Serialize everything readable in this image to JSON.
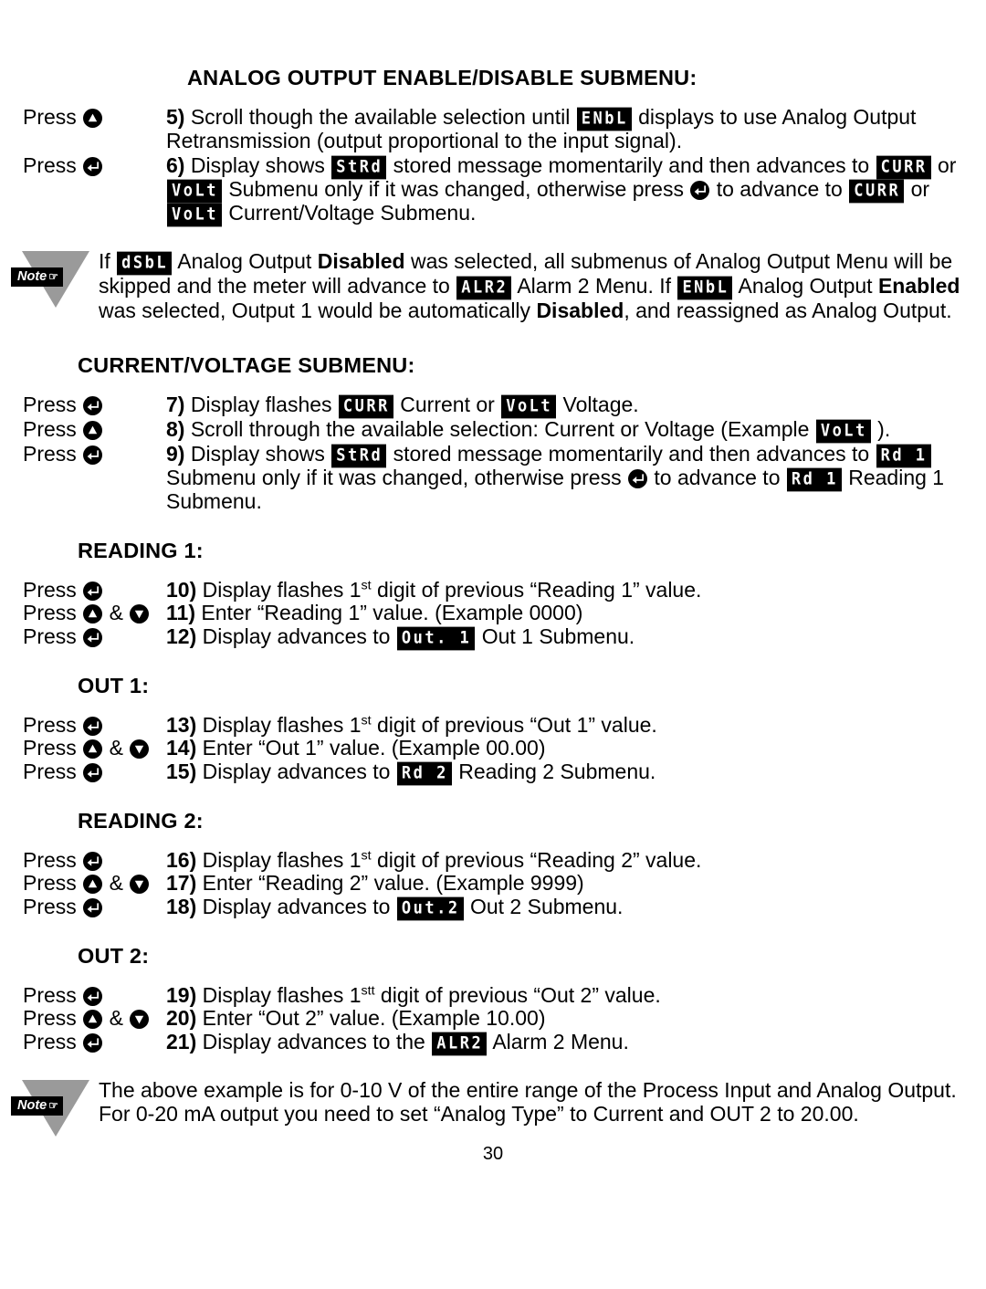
{
  "page": {
    "number": "30"
  },
  "icons": {
    "up": "up-arrow-key-icon",
    "down": "down-arrow-key-icon",
    "enter": "enter-key-icon",
    "note": "note-triangle-icon"
  },
  "note_badge": {
    "label": "Note",
    "hand": "☞"
  },
  "sections": [
    {
      "id": "analog-output-enable-disable-submenu",
      "heading": "ANALOG OUTPUT ENABLE/DISABLE SUBMENU:",
      "rows": [
        {
          "press_label": "Press",
          "keys": [
            "up"
          ],
          "step": "5)",
          "lines": [
            "Scroll though the available selection until ",
            " displays to use Analog Output Retransmission (output proportional to the input signal)."
          ],
          "lcd": [
            "ENbL"
          ]
        },
        {
          "press_label": "Press",
          "keys": [
            "enter"
          ],
          "step": "6)",
          "lcd": [
            "StRd",
            "CURR",
            "VoLt",
            "CURR",
            "VoLt"
          ]
        }
      ]
    },
    {
      "id": "note-analog-disabled",
      "heading": "",
      "note": true
    },
    {
      "id": "current-voltage-submenu",
      "heading": "CURRENT/VOLTAGE SUBMENU:",
      "rows": [
        {
          "press_label": "Press",
          "keys": [
            "enter"
          ],
          "step": "7)",
          "lcd": [
            "CURR",
            "VoLt"
          ]
        },
        {
          "press_label": "Press",
          "keys": [
            "up"
          ],
          "step": "8)",
          "lcd": [
            "VoLt"
          ]
        },
        {
          "press_label": "Press",
          "keys": [
            "enter"
          ],
          "step": "9)",
          "lcd": [
            "StRd",
            "Rd 1",
            "Rd 1"
          ]
        }
      ]
    },
    {
      "id": "reading-1",
      "heading": "READING 1:",
      "rows": [
        {
          "press_label": "Press",
          "keys": [
            "enter"
          ],
          "step": "10)"
        },
        {
          "press_label": "Press",
          "keys": [
            "up",
            "down"
          ],
          "step": "11)"
        },
        {
          "press_label": "Press",
          "keys": [
            "enter"
          ],
          "step": "12)",
          "lcd": [
            "Out. 1"
          ]
        }
      ]
    },
    {
      "id": "out-1",
      "heading": "OUT 1:",
      "rows": [
        {
          "press_label": "Press",
          "keys": [
            "enter"
          ],
          "step": "13)"
        },
        {
          "press_label": "Press",
          "keys": [
            "up",
            "down"
          ],
          "step": "14)"
        },
        {
          "press_label": "Press",
          "keys": [
            "enter"
          ],
          "step": "15)",
          "lcd": [
            "Rd 2"
          ]
        }
      ]
    },
    {
      "id": "reading-2",
      "heading": "READING 2:",
      "rows": [
        {
          "press_label": "Press",
          "keys": [
            "enter"
          ],
          "step": "16)"
        },
        {
          "press_label": "Press",
          "keys": [
            "up",
            "down"
          ],
          "step": "17)"
        },
        {
          "press_label": "Press",
          "keys": [
            "enter"
          ],
          "step": "18)",
          "lcd": [
            "Out.2"
          ]
        }
      ]
    },
    {
      "id": "out-2",
      "heading": "OUT 2:",
      "rows": [
        {
          "press_label": "Press",
          "keys": [
            "enter"
          ],
          "step": "19)"
        },
        {
          "press_label": "Press",
          "keys": [
            "up",
            "down"
          ],
          "step": "20)"
        },
        {
          "press_label": "Press",
          "keys": [
            "enter"
          ],
          "step": "21)",
          "lcd": [
            "ALR2"
          ]
        }
      ]
    }
  ],
  "text": {
    "heading_analog": "ANALOG OUTPUT ENABLE/DISABLE SUBMENU:",
    "heading_current_voltage": "CURRENT/VOLTAGE SUBMENU:",
    "heading_reading_1": "READING 1:",
    "heading_out_1": "OUT 1:",
    "heading_reading_2": "READING 2:",
    "heading_out_2": "OUT 2:",
    "press": "Press",
    "amp": "&",
    "step5_num": "5)",
    "step5_a": "Scroll though the available selection until",
    "step5_lcd": "ENbL",
    "step5_b": "displays to use Analog Output Retransmission (output proportional to the input signal).",
    "step6_num": "6)",
    "step6_a": "Display shows",
    "step6_lcd1": "StRd",
    "step6_b": "stored message momentarily and then advances to",
    "step6_lcd2": "CURR",
    "step6_c": "or",
    "step6_lcd3": "VoLt",
    "step6_d": "Submenu only if it was changed, otherwise press",
    "step6_e": "to advance to",
    "step6_lcd4": "CURR",
    "step6_f": "or",
    "step6_lcd5": "VoLt",
    "step6_g": "Current/Voltage Submenu.",
    "note1_a": "If",
    "note1_lcd1": "dSbL",
    "note1_b": "Analog Output",
    "note1_bold1": "Disabled",
    "note1_c": "was selected, all submenus of Analog Output Menu will be skipped and the meter will advance to",
    "note1_lcd2": "ALR2",
    "note1_d": "Alarm 2 Menu. If",
    "note1_lcd3": "ENbL",
    "note1_e": "Analog Output",
    "note1_bold2": "Enabled",
    "note1_f": "was selected, Output 1 would be automatically",
    "note1_bold3": "Disabled",
    "note1_g": ", and reassigned as Analog Output.",
    "step7_num": "7)",
    "step7_a": "Display flashes",
    "step7_lcd1": "CURR",
    "step7_b": "Current or",
    "step7_lcd2": "VoLt",
    "step7_c": "Voltage.",
    "step8_num": "8)",
    "step8_a": "Scroll through the available selection: Current or Voltage (Example",
    "step8_lcd": "VoLt",
    "step8_b": ").",
    "step9_num": "9)",
    "step9_a": "Display shows",
    "step9_lcd1": "StRd",
    "step9_b": "stored message momentarily and then advances to",
    "step9_lcd2": "Rd 1",
    "step9_c": "Submenu only if it was changed, otherwise press",
    "step9_d": "to advance to",
    "step9_lcd3": "Rd 1",
    "step9_e": "Reading 1 Submenu.",
    "step10_num": "10)",
    "step10_a": "Display flashes 1",
    "step10_ord": "st",
    "step10_b": " digit of previous “Reading 1” value.",
    "step11_num": "11)",
    "step11_a": "Enter “Reading 1” value. (Example 0000)",
    "step12_num": "12)",
    "step12_a": "Display advances to",
    "step12_lcd": "Out. 1",
    "step12_b": "Out 1 Submenu.",
    "step13_num": "13)",
    "step13_a": "Display flashes 1",
    "step13_ord": "st",
    "step13_b": " digit of previous “Out 1” value.",
    "step14_num": "14)",
    "step14_a": "Enter “Out 1” value. (Example 00.00)",
    "step15_num": "15)",
    "step15_a": "Display advances to",
    "step15_lcd": "Rd 2",
    "step15_b": "Reading 2 Submenu.",
    "step16_num": "16)",
    "step16_a": "Display flashes 1",
    "step16_ord": "st",
    "step16_b": " digit of previous “Reading 2” value.",
    "step17_num": "17)",
    "step17_a": "Enter “Reading 2” value. (Example 9999)",
    "step18_num": "18)",
    "step18_a": "Display advances to",
    "step18_lcd": "Out.2",
    "step18_b": "Out 2 Submenu.",
    "step19_num": "19)",
    "step19_a": "Display flashes 1",
    "step19_ord": "stt",
    "step19_b": " digit of previous “Out 2” value.",
    "step20_num": "20)",
    "step20_a": "Enter “Out 2” value. (Example 10.00)",
    "step21_num": "21)",
    "step21_a": "Display advances to the",
    "step21_lcd": "ALR2",
    "step21_b": "Alarm 2 Menu.",
    "note2_a": "The above example is for 0-10 V of the entire range of the Process Input and Analog Output. For 0-20 mA output you need to set “Analog Type” to Current and OUT 2 to 20.00."
  }
}
